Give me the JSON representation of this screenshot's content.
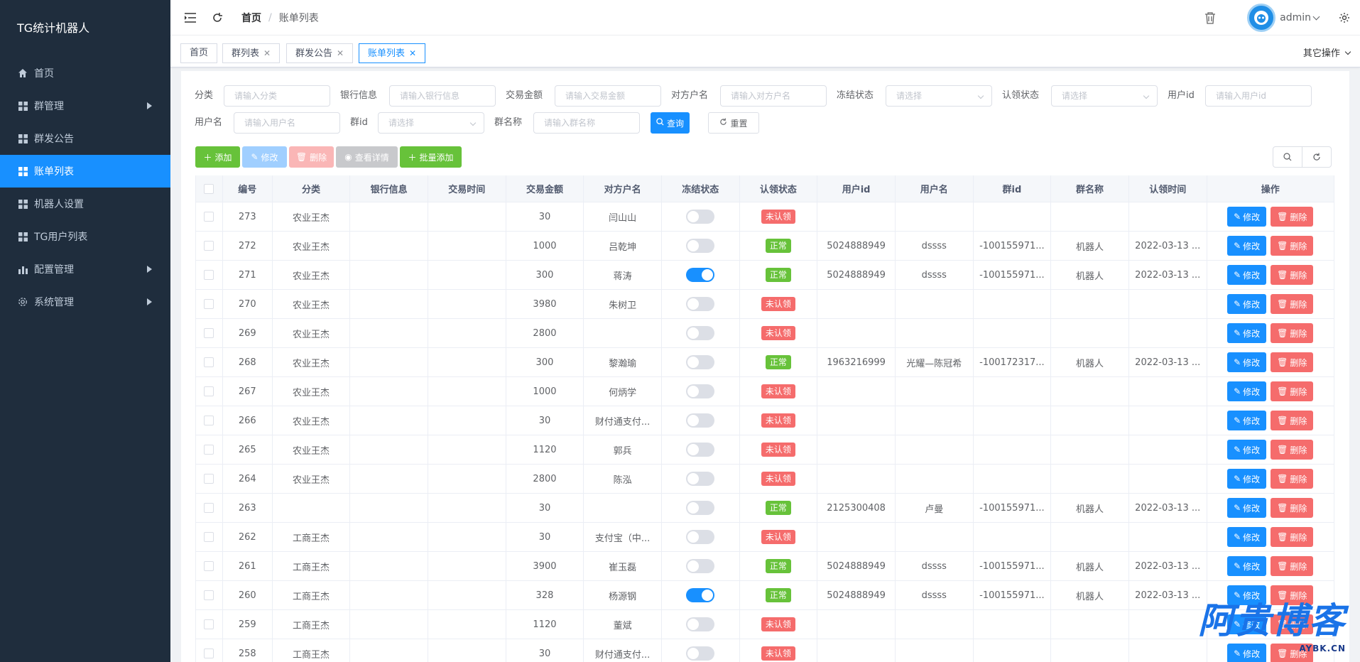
{
  "sidebar": {
    "logo": "TG统计机器人",
    "items": [
      {
        "label": "首页",
        "icon": "home-icon",
        "submenu": false
      },
      {
        "label": "群管理",
        "icon": "grid-icon",
        "submenu": true
      },
      {
        "label": "群发公告",
        "icon": "grid-icon",
        "submenu": false
      },
      {
        "label": "账单列表",
        "icon": "grid-icon",
        "submenu": false,
        "active": true
      },
      {
        "label": "机器人设置",
        "icon": "grid-icon",
        "submenu": false
      },
      {
        "label": "TG用户列表",
        "icon": "grid-icon",
        "submenu": false
      },
      {
        "label": "配置管理",
        "icon": "chart-icon",
        "submenu": true
      },
      {
        "label": "系统管理",
        "icon": "gear-icon",
        "submenu": true
      }
    ]
  },
  "header": {
    "breadcrumb_home": "首页",
    "breadcrumb_sep": "/",
    "breadcrumb_current": "账单列表",
    "username": "admin"
  },
  "tags": {
    "items": [
      "首页",
      "群列表",
      "群发公告",
      "账单列表"
    ],
    "other_ops": "其它操作"
  },
  "filters": {
    "category_label": "分类",
    "category_ph": "请输入分类",
    "bank_label": "银行信息",
    "bank_ph": "请输入银行信息",
    "amount_label": "交易金额",
    "amount_ph": "请输入交易金额",
    "counterparty_label": "对方户名",
    "counterparty_ph": "请输入对方户名",
    "freeze_label": "冻结状态",
    "freeze_ph": "请选择",
    "claim_label": "认领状态",
    "claim_ph": "请选择",
    "userid_label": "用户id",
    "userid_ph": "请输入用户id",
    "username_label": "用户名",
    "username_ph": "请输入用户名",
    "groupid_label": "群id",
    "groupid_ph": "请选择",
    "groupname_label": "群名称",
    "groupname_ph": "请输入群名称",
    "search": "查询",
    "reset": "重置"
  },
  "toolbar": {
    "add": "添加",
    "edit": "修改",
    "delete": "删除",
    "detail": "查看详情",
    "batch_add": "批量添加"
  },
  "table": {
    "columns": [
      "编号",
      "分类",
      "银行信息",
      "交易时间",
      "交易金额",
      "对方户名",
      "冻结状态",
      "认领状态",
      "用户id",
      "用户名",
      "群id",
      "群名称",
      "认领时间",
      "操作"
    ],
    "edit_label": "修改",
    "delete_label": "删除",
    "rows": [
      {
        "id": "273",
        "category": "农业王杰",
        "bank": "",
        "time": "",
        "amount": "30",
        "counterparty": "闫山山",
        "frozen": false,
        "claim": "未认领",
        "claimed": false,
        "userid": "",
        "username": "",
        "groupid": "",
        "groupname": "",
        "claimtime": ""
      },
      {
        "id": "272",
        "category": "农业王杰",
        "bank": "",
        "time": "",
        "amount": "1000",
        "counterparty": "吕乾坤",
        "frozen": false,
        "claim": "正常",
        "claimed": true,
        "userid": "5024888949",
        "username": "dssss",
        "groupid": "-100155971...",
        "groupname": "机器人",
        "claimtime": "2022-03-13 ..."
      },
      {
        "id": "271",
        "category": "农业王杰",
        "bank": "",
        "time": "",
        "amount": "300",
        "counterparty": "蒋涛",
        "frozen": true,
        "claim": "正常",
        "claimed": true,
        "userid": "5024888949",
        "username": "dssss",
        "groupid": "-100155971...",
        "groupname": "机器人",
        "claimtime": "2022-03-13 ..."
      },
      {
        "id": "270",
        "category": "农业王杰",
        "bank": "",
        "time": "",
        "amount": "3980",
        "counterparty": "朱树卫",
        "frozen": false,
        "claim": "未认领",
        "claimed": false,
        "userid": "",
        "username": "",
        "groupid": "",
        "groupname": "",
        "claimtime": ""
      },
      {
        "id": "269",
        "category": "农业王杰",
        "bank": "",
        "time": "",
        "amount": "2800",
        "counterparty": "",
        "frozen": false,
        "claim": "未认领",
        "claimed": false,
        "userid": "",
        "username": "",
        "groupid": "",
        "groupname": "",
        "claimtime": ""
      },
      {
        "id": "268",
        "category": "农业王杰",
        "bank": "",
        "time": "",
        "amount": "300",
        "counterparty": "黎瀚瑜",
        "frozen": false,
        "claim": "正常",
        "claimed": true,
        "userid": "1963216999",
        "username": "光耀—陈冠希",
        "groupid": "-100172317...",
        "groupname": "机器人",
        "claimtime": "2022-03-13 ..."
      },
      {
        "id": "267",
        "category": "农业王杰",
        "bank": "",
        "time": "",
        "amount": "1000",
        "counterparty": "何炳学",
        "frozen": false,
        "claim": "未认领",
        "claimed": false,
        "userid": "",
        "username": "",
        "groupid": "",
        "groupname": "",
        "claimtime": ""
      },
      {
        "id": "266",
        "category": "农业王杰",
        "bank": "",
        "time": "",
        "amount": "30",
        "counterparty": "财付通支付...",
        "frozen": false,
        "claim": "未认领",
        "claimed": false,
        "userid": "",
        "username": "",
        "groupid": "",
        "groupname": "",
        "claimtime": ""
      },
      {
        "id": "265",
        "category": "农业王杰",
        "bank": "",
        "time": "",
        "amount": "1120",
        "counterparty": "郭兵",
        "frozen": false,
        "claim": "未认领",
        "claimed": false,
        "userid": "",
        "username": "",
        "groupid": "",
        "groupname": "",
        "claimtime": ""
      },
      {
        "id": "264",
        "category": "农业王杰",
        "bank": "",
        "time": "",
        "amount": "2800",
        "counterparty": "陈泓",
        "frozen": false,
        "claim": "未认领",
        "claimed": false,
        "userid": "",
        "username": "",
        "groupid": "",
        "groupname": "",
        "claimtime": ""
      },
      {
        "id": "263",
        "category": "",
        "bank": "",
        "time": "",
        "amount": "30",
        "counterparty": "",
        "frozen": false,
        "claim": "正常",
        "claimed": true,
        "userid": "2125300408",
        "username": "卢曼",
        "groupid": "-100155971...",
        "groupname": "机器人",
        "claimtime": "2022-03-13 ..."
      },
      {
        "id": "262",
        "category": "工商王杰",
        "bank": "",
        "time": "",
        "amount": "30",
        "counterparty": "支付宝（中...",
        "frozen": false,
        "claim": "未认领",
        "claimed": false,
        "userid": "",
        "username": "",
        "groupid": "",
        "groupname": "",
        "claimtime": ""
      },
      {
        "id": "261",
        "category": "工商王杰",
        "bank": "",
        "time": "",
        "amount": "3900",
        "counterparty": "崔玉磊",
        "frozen": false,
        "claim": "正常",
        "claimed": true,
        "userid": "5024888949",
        "username": "dssss",
        "groupid": "-100155971...",
        "groupname": "机器人",
        "claimtime": "2022-03-13 ..."
      },
      {
        "id": "260",
        "category": "工商王杰",
        "bank": "",
        "time": "",
        "amount": "328",
        "counterparty": "杨源钢",
        "frozen": true,
        "claim": "正常",
        "claimed": true,
        "userid": "5024888949",
        "username": "dssss",
        "groupid": "-100155971...",
        "groupname": "机器人",
        "claimtime": "2022-03-13 ..."
      },
      {
        "id": "259",
        "category": "工商王杰",
        "bank": "",
        "time": "",
        "amount": "1120",
        "counterparty": "董斌",
        "frozen": false,
        "claim": "未认领",
        "claimed": false,
        "userid": "",
        "username": "",
        "groupid": "",
        "groupname": "",
        "claimtime": ""
      },
      {
        "id": "258",
        "category": "工商王杰",
        "bank": "",
        "time": "",
        "amount": "30",
        "counterparty": "财付通支付...",
        "frozen": false,
        "claim": "未认领",
        "claimed": false,
        "userid": "",
        "username": "",
        "groupid": "",
        "groupname": "",
        "claimtime": ""
      }
    ]
  },
  "watermark": {
    "main": "阿贵博客",
    "sub": "AYBK.CN"
  },
  "colors": {
    "primary": "#1890ff",
    "success": "#67c23a",
    "danger": "#f56c6c",
    "sidebar_bg": "#1f2d3d"
  }
}
